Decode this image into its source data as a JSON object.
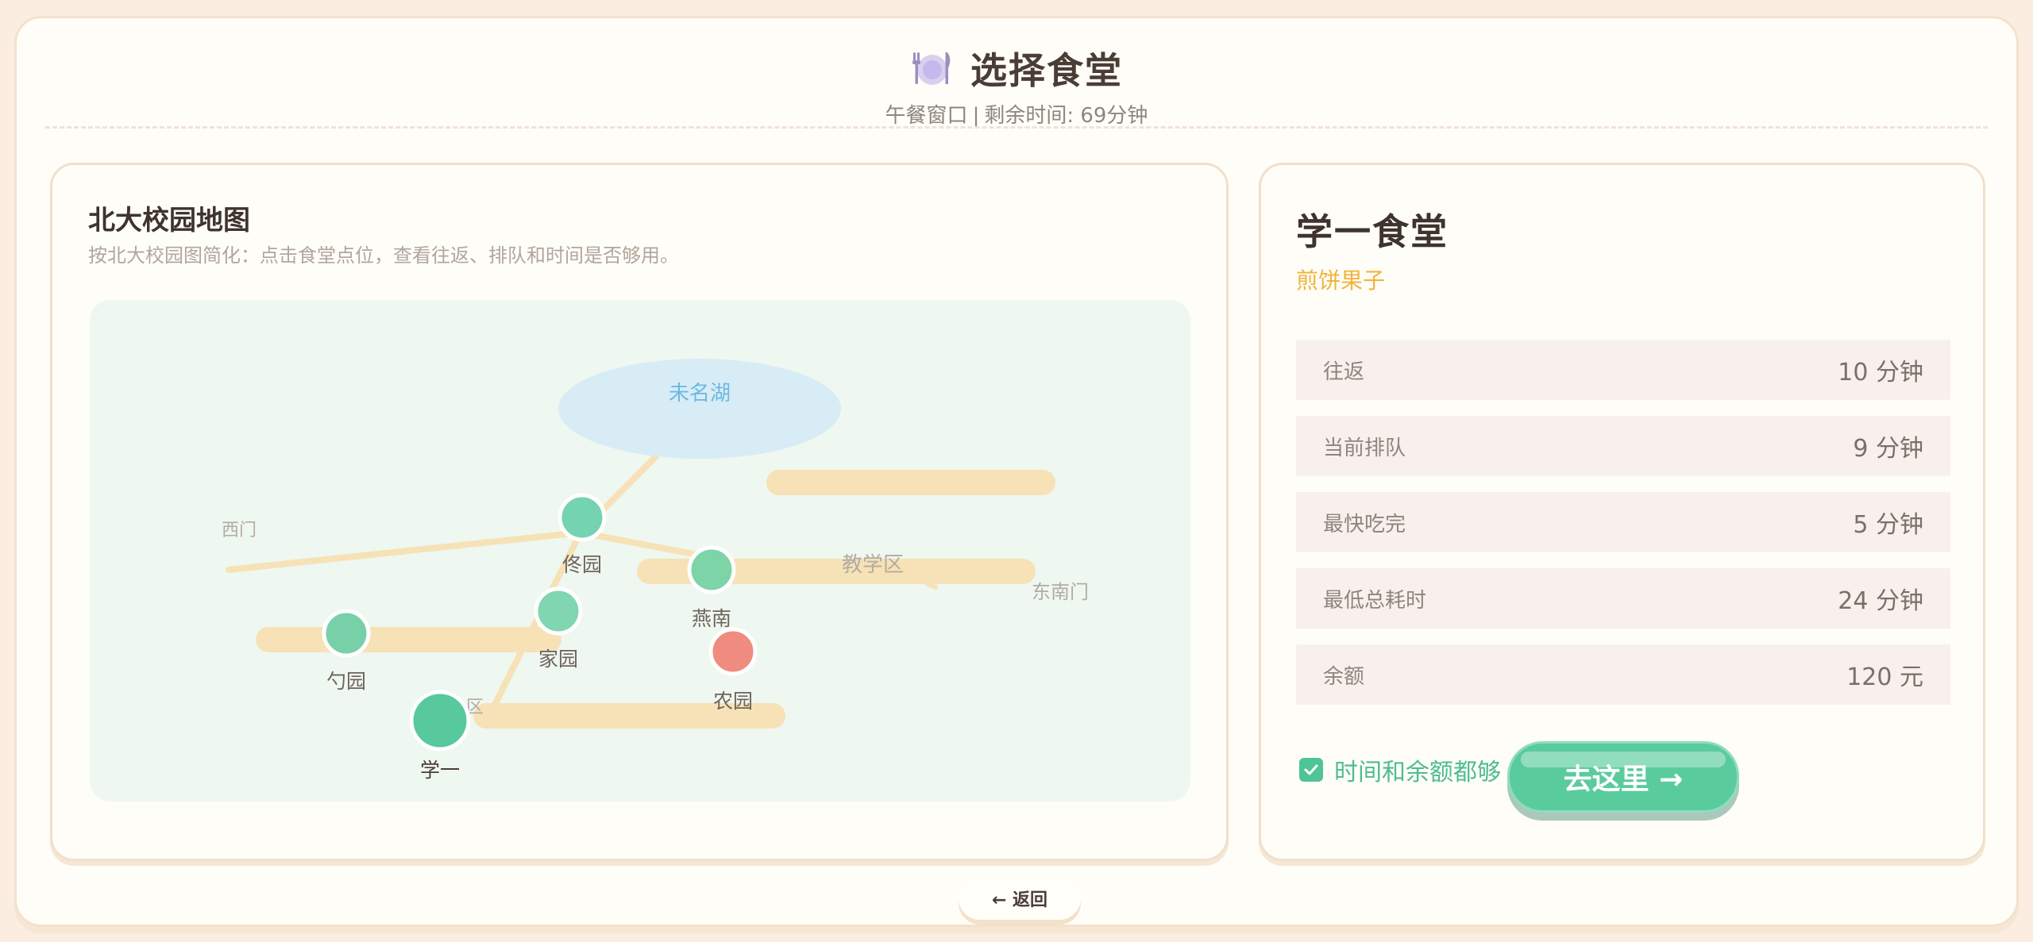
{
  "header": {
    "title": "选择食堂",
    "icon": "plate-utensils-icon",
    "window": "午餐窗口",
    "separator": "|",
    "remaining": "剩余时间: 69分钟"
  },
  "map": {
    "title": "北大校园地图",
    "description": "按北大校园图简化：点击食堂点位，查看往返、排队和时间是否够用。",
    "landmarks": {
      "lake": "未名湖",
      "west_gate": "西门",
      "teaching_area": "教学区",
      "southeast_gate": "东南门",
      "zone_partial": "区"
    },
    "canteens": [
      {
        "id": "tongyuan",
        "label": "佟园",
        "status": "ok",
        "color": "#74d3b0"
      },
      {
        "id": "yannan",
        "label": "燕南",
        "status": "ok",
        "color": "#7dd4a7"
      },
      {
        "id": "jiayuan",
        "label": "家园",
        "status": "ok",
        "color": "#7fd6b1"
      },
      {
        "id": "shaoyuan",
        "label": "勺园",
        "status": "ok",
        "color": "#78d0a8"
      },
      {
        "id": "nongyuan",
        "label": "农园",
        "status": "unavailable",
        "color": "#ef8b7f"
      },
      {
        "id": "xueyi",
        "label": "学一",
        "status": "selected",
        "color": "#57c99c"
      }
    ]
  },
  "detail": {
    "name": "学一食堂",
    "dish": "煎饼果子",
    "rows": [
      {
        "label": "往返",
        "value": "10 分钟"
      },
      {
        "label": "当前排队",
        "value": "9 分钟"
      },
      {
        "label": "最快吃完",
        "value": "5 分钟"
      },
      {
        "label": "最低总耗时",
        "value": "24 分钟"
      },
      {
        "label": "余额",
        "value": "120 元"
      }
    ],
    "check_text": "时间和余额都够",
    "go_label": "去这里 →"
  },
  "footer": {
    "back_label": "← 返回"
  },
  "colors": {
    "accent": "#5acb9d",
    "background": "#fffdf7",
    "unavailable": "#ef8b7f",
    "dish": "#f0b43c"
  }
}
